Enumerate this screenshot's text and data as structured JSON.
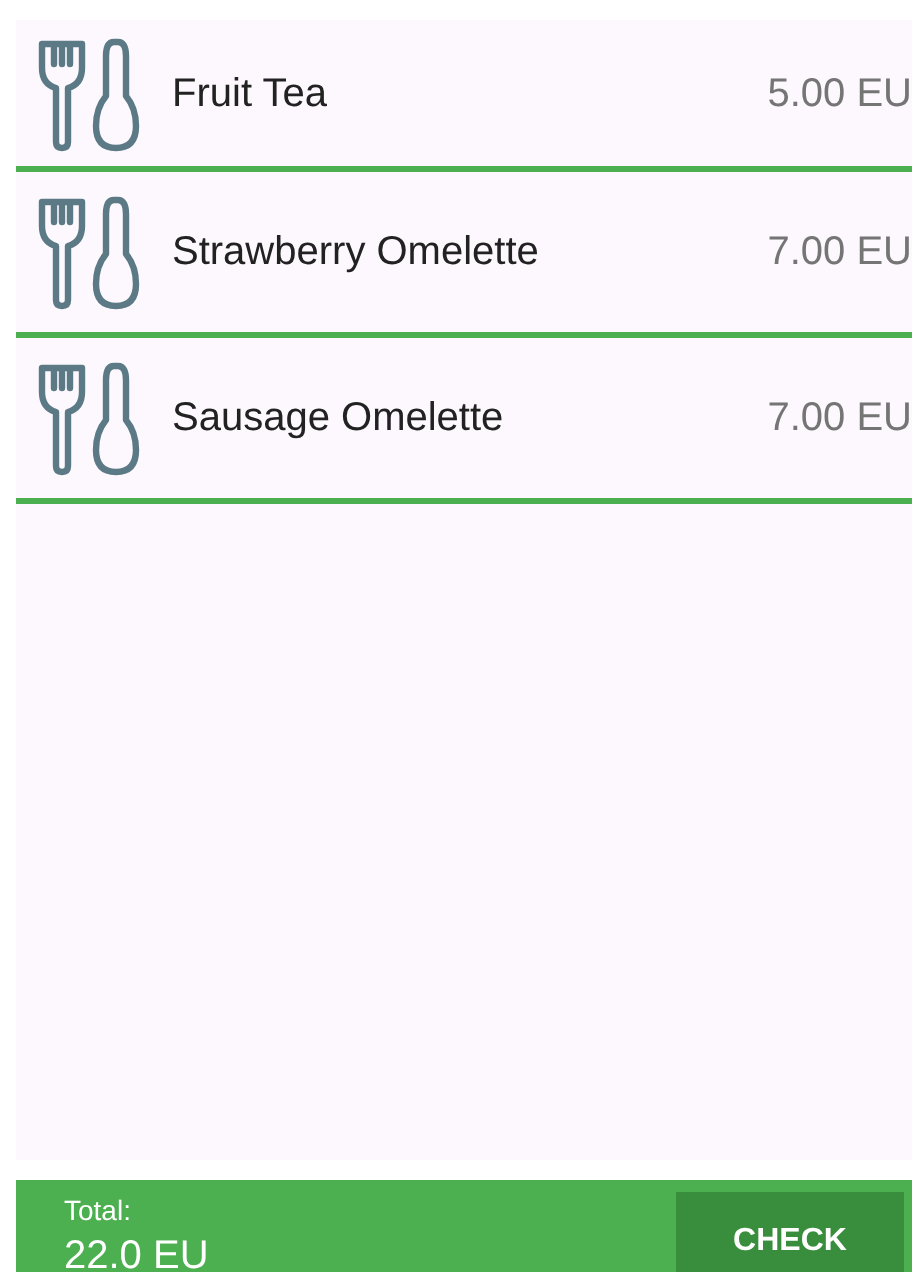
{
  "items": [
    {
      "name": "Fruit Tea",
      "price": "5.00 EU"
    },
    {
      "name": "Strawberry Omelette",
      "price": "7.00 EU"
    },
    {
      "name": "Sausage Omelette",
      "price": "7.00 EU"
    }
  ],
  "footer": {
    "total_label": "Total:",
    "total_value": "22.0 EU",
    "button": "CHECK"
  }
}
